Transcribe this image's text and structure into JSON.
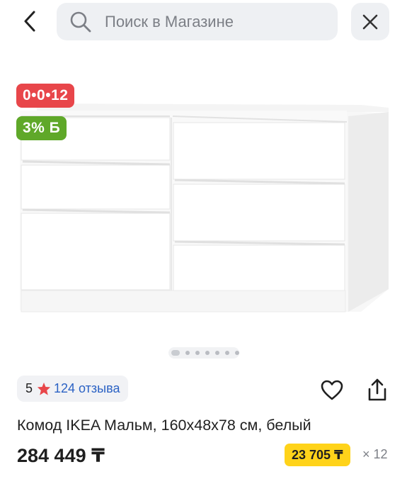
{
  "header": {
    "search_placeholder": "Поиск в Магазине"
  },
  "gallery": {
    "badge_installment": "0•0•12",
    "badge_bonus": "3% Б",
    "slide_count": 7,
    "active_slide": 1
  },
  "rating": {
    "score": "5",
    "reviews": "124 отзыва"
  },
  "product": {
    "title": "Комод IKEA Мальм, 160x48x78 см, белый",
    "price": "284 449 ₸",
    "monthly_payment": "23 705 ₸",
    "multiplier": "× 12"
  },
  "colors": {
    "installment_badge": "#e8464a",
    "bonus_badge": "#5fa829",
    "monthly_highlight": "#ffd31a",
    "reviews_link": "#2b62c4",
    "star": "#e8464a"
  }
}
